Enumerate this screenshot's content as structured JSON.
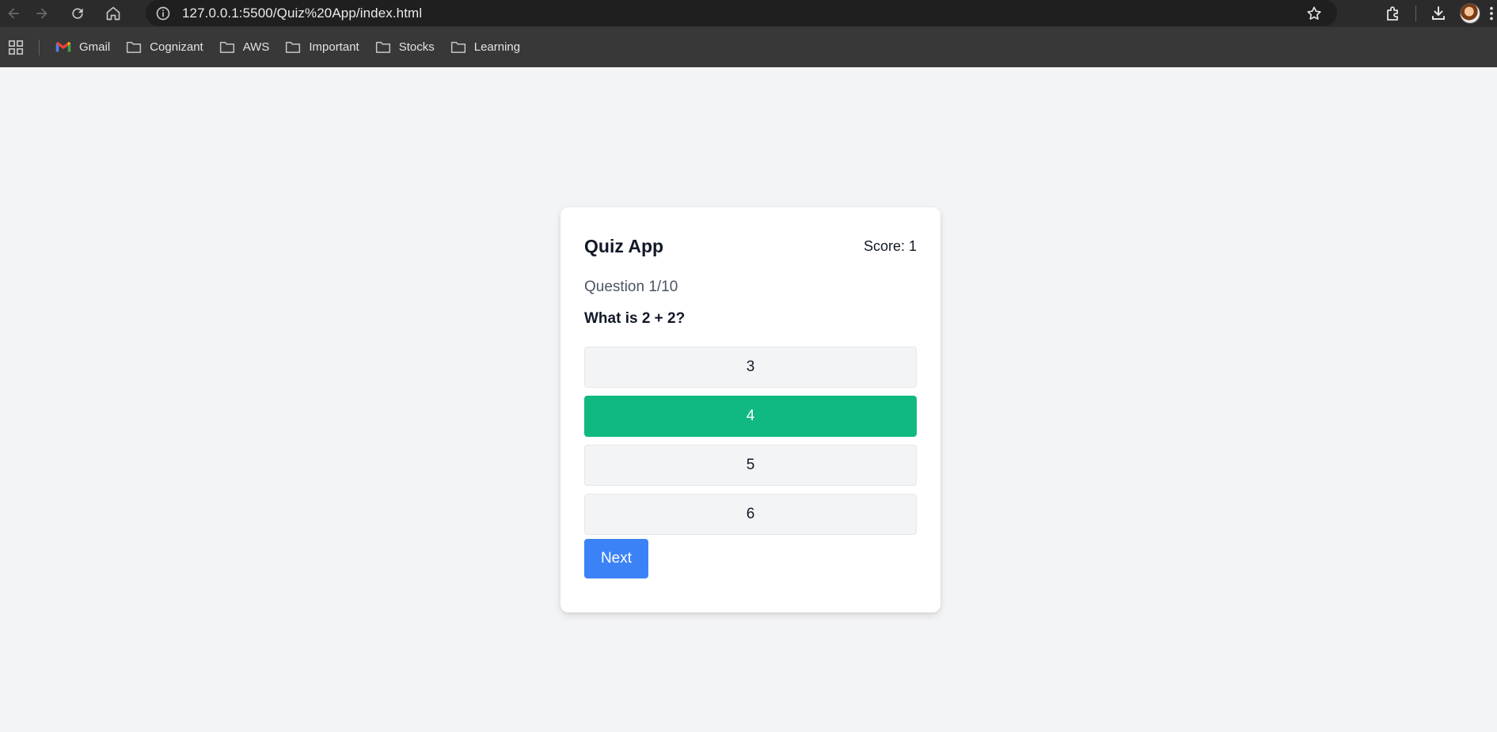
{
  "browser": {
    "url": "127.0.0.1:5500/Quiz%20App/index.html",
    "icons": [
      "back-arrow-icon",
      "forward-arrow-icon",
      "reload-icon",
      "home-icon",
      "site-info-icon",
      "bookmark-star-icon",
      "extensions-icon",
      "download-icon",
      "profile-avatar",
      "menu-dots-icon"
    ],
    "bookmarks": [
      {
        "label": "Gmail",
        "icon": "gmail-icon"
      },
      {
        "label": "Cognizant",
        "icon": "folder-icon"
      },
      {
        "label": "AWS",
        "icon": "folder-icon"
      },
      {
        "label": "Important",
        "icon": "folder-icon"
      },
      {
        "label": "Stocks",
        "icon": "folder-icon"
      },
      {
        "label": "Learning",
        "icon": "folder-icon"
      }
    ]
  },
  "quiz": {
    "title": "Quiz App",
    "score_text": "Score: 1",
    "question_counter": "Question 1/10",
    "question": "What is 2 + 2?",
    "options": [
      {
        "label": "3",
        "state": "default"
      },
      {
        "label": "4",
        "state": "correct"
      },
      {
        "label": "5",
        "state": "default"
      },
      {
        "label": "6",
        "state": "default"
      }
    ],
    "next_label": "Next"
  },
  "colors": {
    "page_background": "#f3f4f6",
    "correct": "#10b981",
    "primary_button": "#3b82f6",
    "browser_chrome": "#2b2b2b",
    "bookmarks_bar": "#383838"
  }
}
